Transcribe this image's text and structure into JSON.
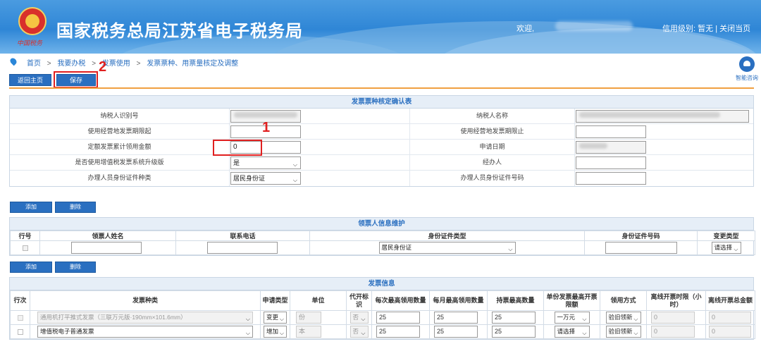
{
  "header": {
    "title": "国家税务总局江苏省电子税务局",
    "emblem_sub": "中国税务",
    "welcome": "欢迎,",
    "credit_label": "信用级别:",
    "credit_value": "暂无",
    "separator": "|",
    "close_label": "关闭当页"
  },
  "breadcrumb": {
    "items": [
      "首页",
      "我要办税",
      "发票使用",
      "发票票种、用票量核定及调整"
    ],
    "sep": ">"
  },
  "help": {
    "label": "智能咨询"
  },
  "actions": {
    "home": "返回主页",
    "save": "保存"
  },
  "annotations": {
    "one": "1",
    "two": "2"
  },
  "form": {
    "title": "发票票种核定确认表",
    "rows": [
      {
        "l1": "纳税人识别号",
        "l2": "纳税人名称"
      },
      {
        "l1": "使用经营地发票期限起",
        "l2": "使用经营地发票期限止"
      },
      {
        "l1": "定额发票累计领用金额",
        "v1": "0",
        "l2": "申请日期"
      },
      {
        "l1": "是否使用增值税发票系统升级版",
        "v1": "是",
        "l2": "经办人"
      },
      {
        "l1": "办理人员身份证件种类",
        "v1": "居民身份证",
        "l2": "办理人员身份证件号码"
      }
    ]
  },
  "buttons": {
    "add": "添加",
    "del": "删除"
  },
  "recipient": {
    "title": "领票人信息维护",
    "headers": [
      "行号",
      "领票人姓名",
      "联系电话",
      "身份证件类型",
      "身份证件号码",
      "变更类型"
    ],
    "row": {
      "id_type": "居民身份证",
      "change": "请选择"
    }
  },
  "invoice": {
    "title": "发票信息",
    "headers": [
      "行次",
      "发票种类",
      "申请类型",
      "单位",
      "代开标识",
      "每次最高领用数量",
      "每月最高领用数量",
      "持票最高数量",
      "单份发票最高开票限额",
      "领用方式",
      "离线开票时限（小时）",
      "离线开票总金额"
    ],
    "rows": [
      {
        "kind": "通用机打平推式发票（三联万元版·190mm×101.6mm）",
        "apply": "变更",
        "unit": "份",
        "proxy": "否",
        "per_time": "25",
        "per_month": "25",
        "max_hold": "25",
        "limit": "一万元",
        "method": "验旧领新",
        "offline_hours": "0",
        "offline_total": "0"
      },
      {
        "kind": "增值税电子普通发票",
        "apply": "增加",
        "unit": "本",
        "proxy": "否",
        "per_time": "25",
        "per_month": "25",
        "max_hold": "25",
        "limit": "请选择",
        "method": "验旧领新",
        "offline_hours": "0",
        "offline_total": "0"
      }
    ]
  }
}
